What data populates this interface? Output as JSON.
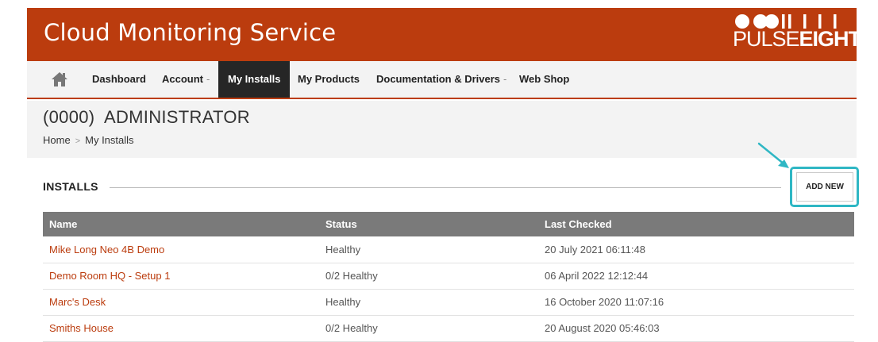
{
  "header": {
    "title": "Cloud Monitoring Service",
    "brand_color": "#bb3c0e",
    "logo": {
      "text_light": "PULSE",
      "text_bold": "EIGHT"
    }
  },
  "nav": {
    "home_icon": "home-icon",
    "items": [
      {
        "label": "Dashboard",
        "dropdown": false,
        "active": false
      },
      {
        "label": "Account",
        "dropdown": true,
        "active": false
      },
      {
        "label": "My Installs",
        "dropdown": false,
        "active": true
      },
      {
        "label": "My Products",
        "dropdown": false,
        "active": false
      },
      {
        "label": "Documentation & Drivers",
        "dropdown": true,
        "active": false
      },
      {
        "label": "Web Shop",
        "dropdown": false,
        "active": false
      }
    ]
  },
  "page": {
    "title": "(0000)  ADMINISTRATOR",
    "breadcrumb": {
      "home": "Home",
      "current": "My Installs",
      "separator": ">"
    }
  },
  "section": {
    "title": "INSTALLS",
    "add_button_label": "ADD NEW",
    "highlight_color": "#2fb7c4"
  },
  "table": {
    "headers": {
      "name": "Name",
      "status": "Status",
      "last_checked": "Last Checked"
    },
    "rows": [
      {
        "name": "Mike Long Neo 4B Demo",
        "status": "Healthy",
        "last_checked": "20 July 2021 06:11:48"
      },
      {
        "name": "Demo Room HQ - Setup 1",
        "status": "0/2 Healthy",
        "last_checked": "06 April 2022 12:12:44"
      },
      {
        "name": "Marc's Desk",
        "status": "Healthy",
        "last_checked": "16 October 2020 11:07:16"
      },
      {
        "name": "Smiths House",
        "status": "0/2 Healthy",
        "last_checked": "20 August 2020 05:46:03"
      }
    ]
  }
}
